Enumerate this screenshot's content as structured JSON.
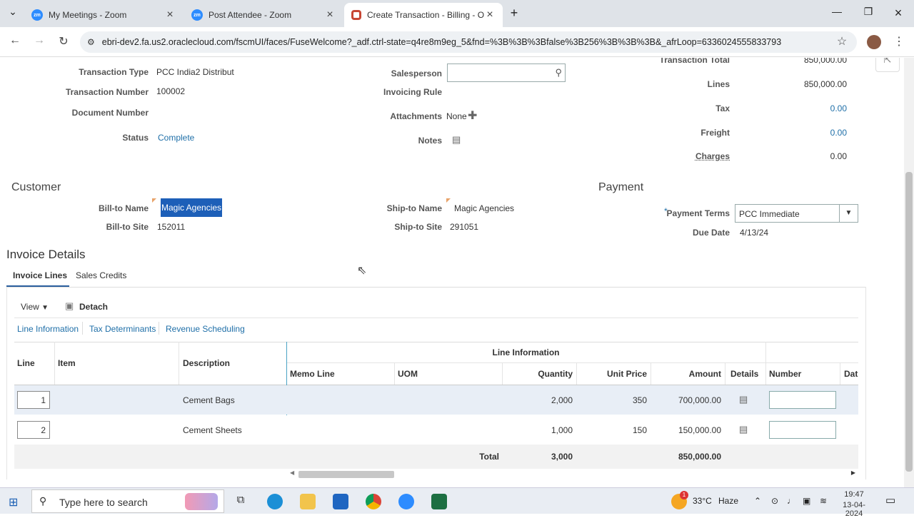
{
  "browser": {
    "tabs": [
      {
        "title": "My Meetings - Zoom",
        "icon": "zoom"
      },
      {
        "title": "Post Attendee - Zoom",
        "icon": "zoom"
      },
      {
        "title": "Create Transaction - Billing - O",
        "icon": "oracle"
      }
    ],
    "url": "ebri-dev2.fa.us2.oraclecloud.com/fscmUI/faces/FuseWelcome?_adf.ctrl-state=q4re8m9eg_5&fnd=%3B%3B%3Bfalse%3B256%3B%3B%3B&_afrLoop=6336024555833793"
  },
  "header": {
    "transaction_type_label": "Transaction Type",
    "transaction_type": "PCC India2 Distribut",
    "transaction_number_label": "Transaction Number",
    "transaction_number": "100002",
    "document_number_label": "Document Number",
    "status_label": "Status",
    "status": "Complete",
    "salesperson_label": "Salesperson",
    "invoicing_rule_label": "Invoicing Rule",
    "attachments_label": "Attachments",
    "attachments": "None",
    "notes_label": "Notes"
  },
  "totals": {
    "transaction_total_label": "Transaction Total",
    "transaction_total": "850,000.00",
    "lines_label": "Lines",
    "lines": "850,000.00",
    "tax_label": "Tax",
    "tax": "0.00",
    "freight_label": "Freight",
    "freight": "0.00",
    "charges_label": "Charges",
    "charges": "0.00"
  },
  "customer": {
    "section": "Customer",
    "bill_to_name_label": "Bill-to Name",
    "bill_to_name": "Magic Agencies",
    "bill_to_site_label": "Bill-to Site",
    "bill_to_site": "152011",
    "ship_to_name_label": "Ship-to Name",
    "ship_to_name": "Magic Agencies",
    "ship_to_site_label": "Ship-to Site",
    "ship_to_site": "291051"
  },
  "payment": {
    "section": "Payment",
    "required": "*",
    "terms_label": "Payment Terms",
    "terms": "PCC Immediate",
    "due_date_label": "Due Date",
    "due_date": "4/13/24"
  },
  "invoice": {
    "title": "Invoice Details",
    "tabs": [
      "Invoice Lines",
      "Sales Credits"
    ],
    "view_label": "View",
    "detach_label": "Detach",
    "subtabs": [
      "Line Information",
      "Tax Determinants",
      "Revenue Scheduling"
    ],
    "group_header": "Line Information",
    "columns": {
      "line": "Line",
      "item": "Item",
      "description": "Description",
      "memo": "Memo Line",
      "uom": "UOM",
      "quantity": "Quantity",
      "unit_price": "Unit Price",
      "amount": "Amount",
      "details": "Details",
      "number": "Number",
      "date": "Dat"
    },
    "rows": [
      {
        "line": "1",
        "description": "Cement Bags",
        "quantity": "2,000",
        "unit_price": "350",
        "amount": "700,000.00"
      },
      {
        "line": "2",
        "description": "Cement Sheets",
        "quantity": "1,000",
        "unit_price": "150",
        "amount": "150,000.00"
      }
    ],
    "total_label": "Total",
    "total_quantity": "3,000",
    "total_amount": "850,000.00"
  },
  "taskbar": {
    "search": "Type here to search",
    "weather": "33°C",
    "condition": "Haze",
    "time": "19:47",
    "date": "13-04-2024",
    "badge": "1"
  }
}
